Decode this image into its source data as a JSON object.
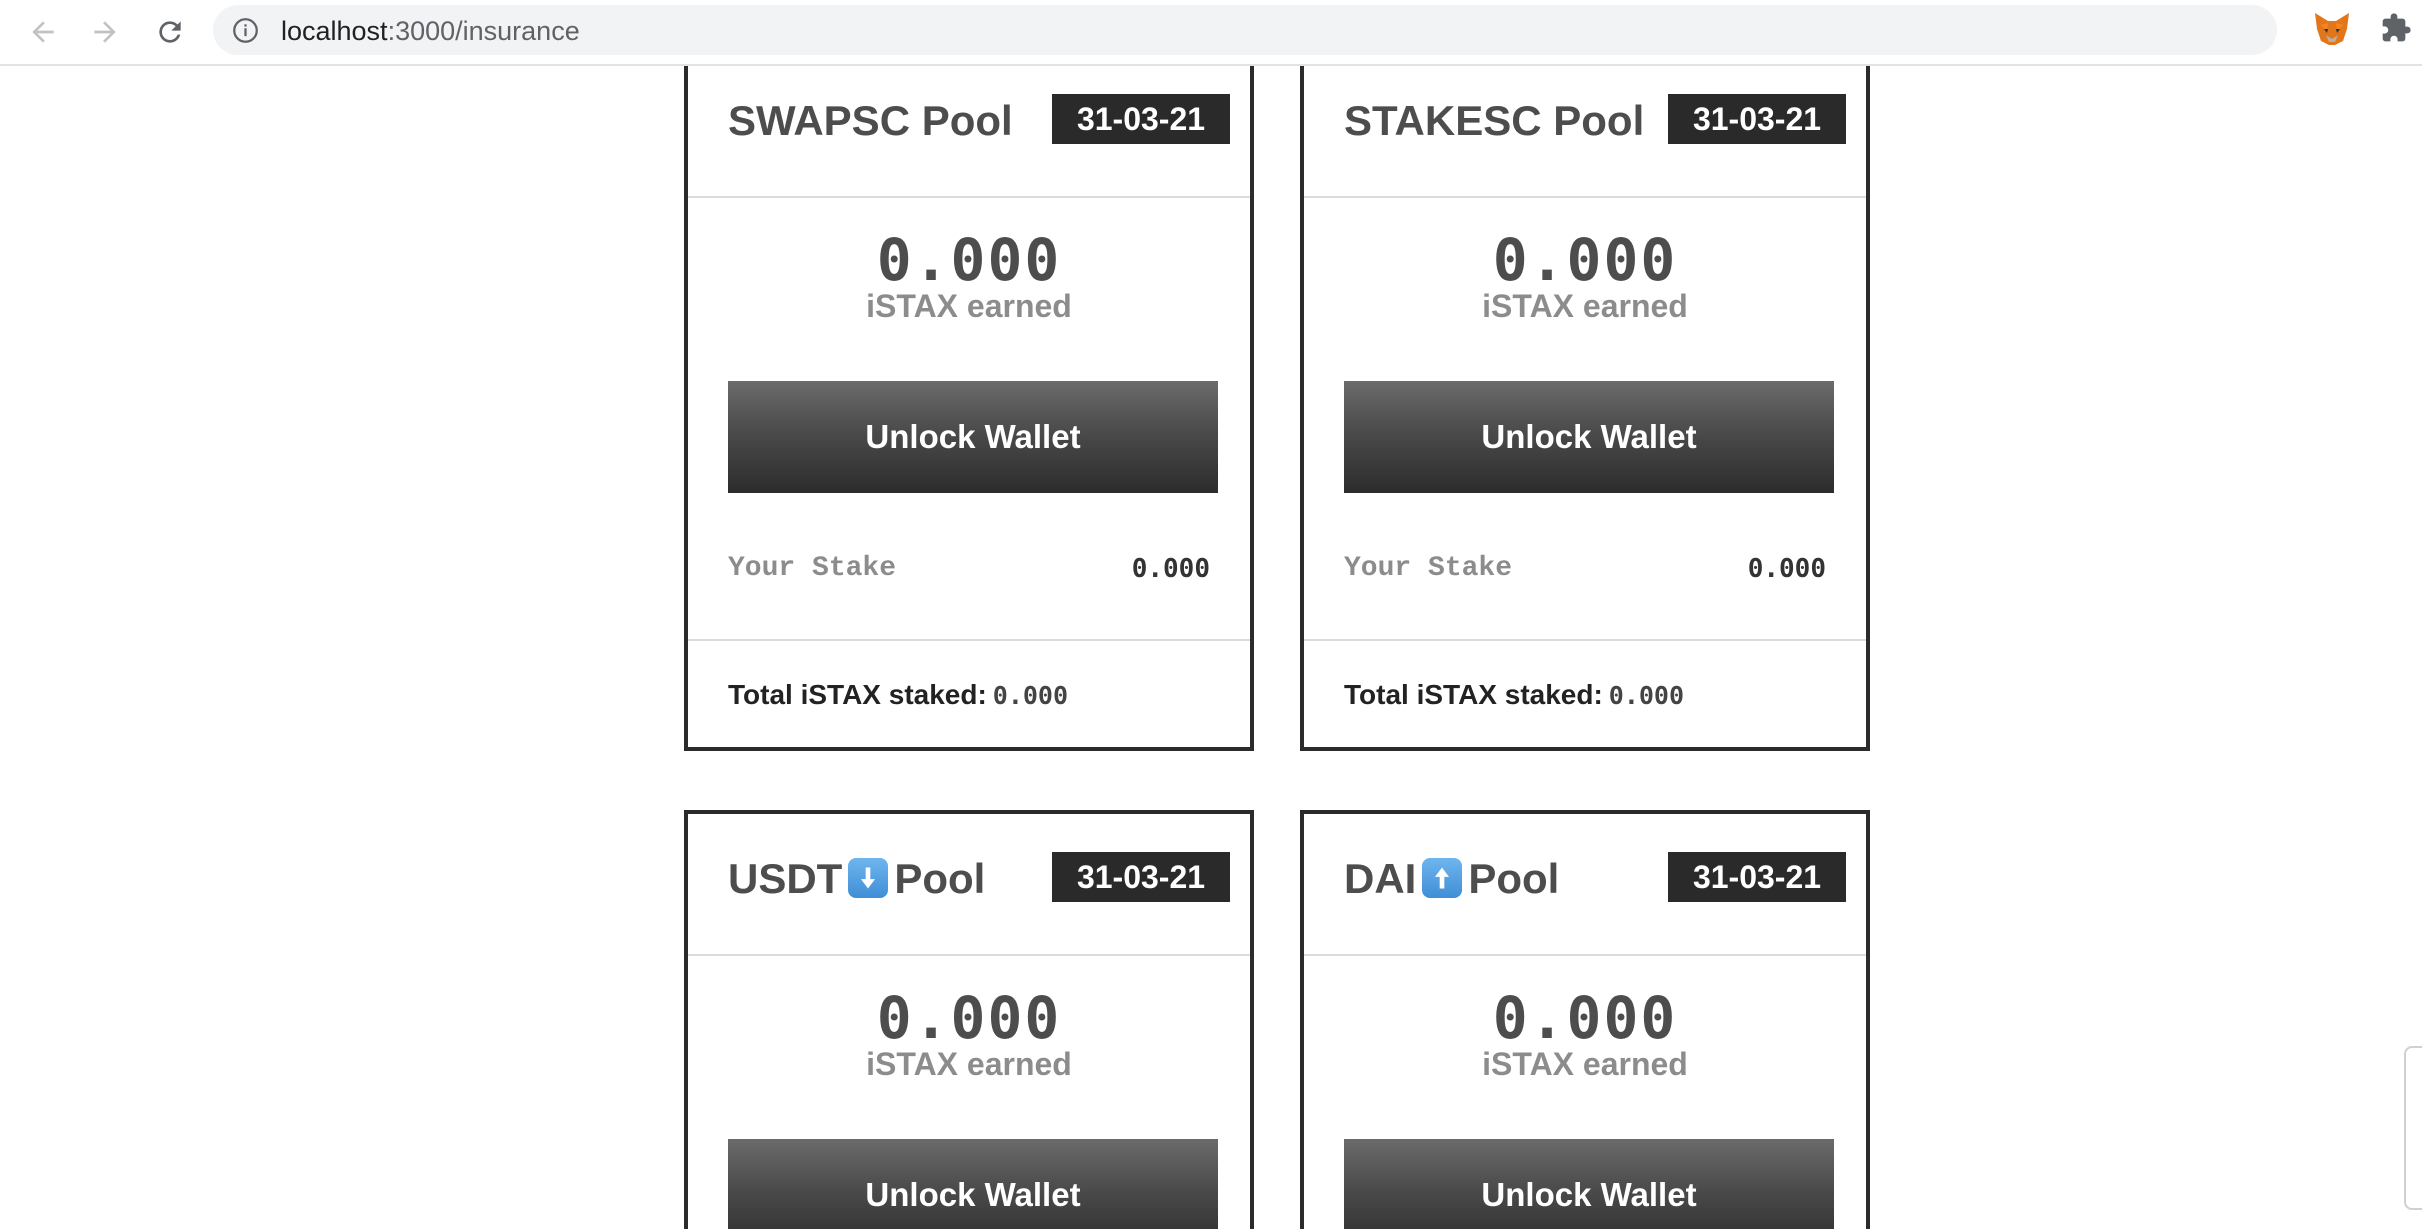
{
  "browser": {
    "url_host": "localhost",
    "url_path": ":3000/insurance"
  },
  "pools": [
    {
      "name_before": "SWAPSC",
      "arrow": "",
      "name_after": "Pool",
      "date": "31-03-21",
      "earned_value": "0.000",
      "earned_label": "iSTAX earned",
      "button_label": "Unlock Wallet",
      "stake_label": "Your Stake",
      "stake_value": "0.000",
      "total_label": "Total iSTAX staked:",
      "total_value": "0.000"
    },
    {
      "name_before": "STAKESC",
      "arrow": "",
      "name_after": "Pool",
      "date": "31-03-21",
      "earned_value": "0.000",
      "earned_label": "iSTAX earned",
      "button_label": "Unlock Wallet",
      "stake_label": "Your Stake",
      "stake_value": "0.000",
      "total_label": "Total iSTAX staked:",
      "total_value": "0.000"
    },
    {
      "name_before": "USDT",
      "arrow": "down-arrow-icon",
      "name_after": "Pool",
      "date": "31-03-21",
      "earned_value": "0.000",
      "earned_label": "iSTAX earned",
      "button_label": "Unlock Wallet"
    },
    {
      "name_before": "DAI",
      "arrow": "up-arrow-icon",
      "name_after": "Pool",
      "date": "31-03-21",
      "earned_value": "0.000",
      "earned_label": "iSTAX earned",
      "button_label": "Unlock Wallet"
    }
  ]
}
